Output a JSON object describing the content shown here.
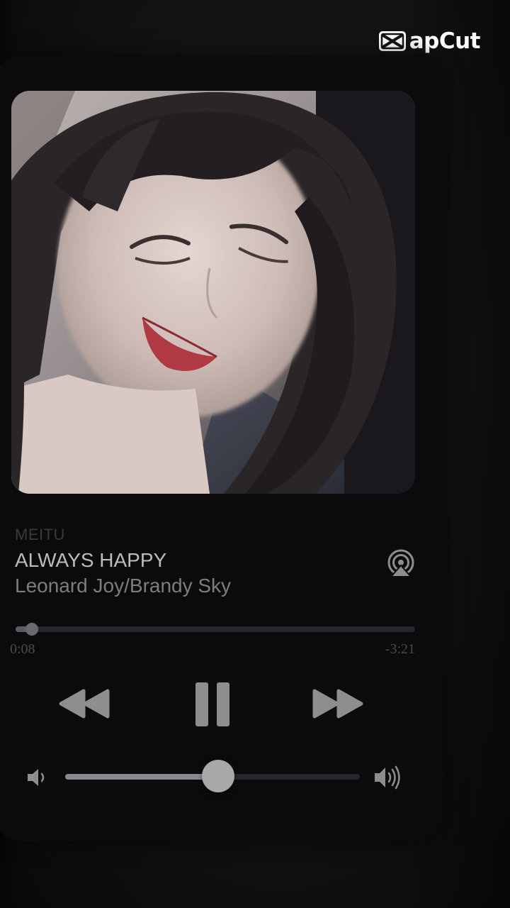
{
  "watermark": {
    "brand": "CapCut",
    "visible_text": "apCut"
  },
  "artwork": {
    "description_icon": "album-art-portrait"
  },
  "track": {
    "source": "MEITU",
    "title": "ALWAYS HAPPY",
    "artist": "Leonard Joy/Brandy Sky"
  },
  "progress": {
    "elapsed": "0:08",
    "remaining": "-3:21",
    "fraction": 0.04
  },
  "controls": {
    "rewind_icon": "rewind-icon",
    "pause_icon": "pause-icon",
    "forward_icon": "fast-forward-icon",
    "airplay_icon": "airplay-icon"
  },
  "volume": {
    "level": 0.52,
    "low_icon": "volume-low-icon",
    "high_icon": "volume-high-icon"
  },
  "colors": {
    "background": "#141416",
    "card": "#0b0b0d",
    "title_text": "#bcbcbc",
    "artist_text": "#7d7d80",
    "controls": "#8e8e90"
  }
}
